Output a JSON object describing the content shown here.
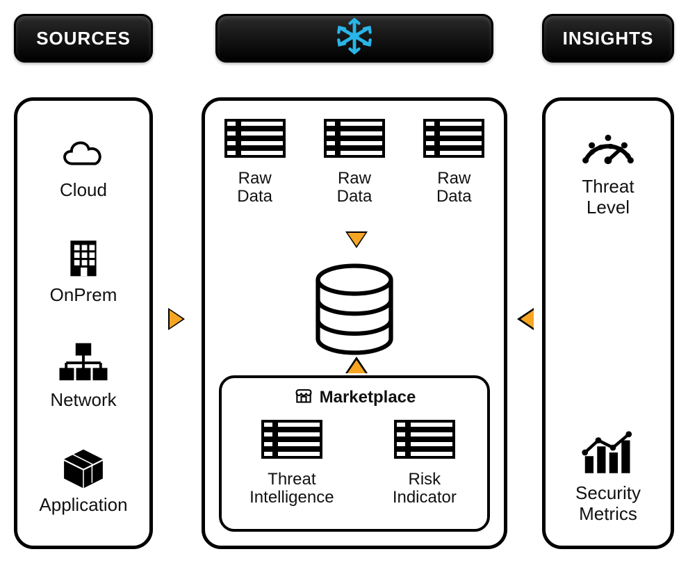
{
  "headers": {
    "sources": "SOURCES",
    "insights": "INSIGHTS"
  },
  "center": {
    "brand_icon": "snowflake-icon",
    "raw_data": [
      {
        "label": "Raw\nData"
      },
      {
        "label": "Raw\nData"
      },
      {
        "label": "Raw\nData"
      }
    ],
    "database_icon": "database-icon",
    "marketplace": {
      "title": "Marketplace",
      "items": [
        {
          "label": "Threat\nIntelligence",
          "icon": "table-icon"
        },
        {
          "label": "Risk\nIndicator",
          "icon": "table-icon"
        }
      ]
    }
  },
  "sources": [
    {
      "label": "Cloud",
      "icon": "cloud-icon"
    },
    {
      "label": "OnPrem",
      "icon": "building-icon"
    },
    {
      "label": "Network",
      "icon": "network-icon"
    },
    {
      "label": "Application",
      "icon": "package-icon"
    }
  ],
  "insights": [
    {
      "label": "Threat\nLevel",
      "icon": "gauge-icon"
    },
    {
      "label": "Security\nMetrics",
      "icon": "chart-icon"
    }
  ],
  "arrows": [
    {
      "name": "sources-to-center",
      "direction": "right"
    },
    {
      "name": "insights-to-center",
      "direction": "left"
    },
    {
      "name": "rawdata-to-db",
      "direction": "down"
    },
    {
      "name": "marketplace-to-db",
      "direction": "up"
    }
  ],
  "colors": {
    "accent_orange": "#f6a623",
    "brand_blue": "#29b5e8"
  }
}
